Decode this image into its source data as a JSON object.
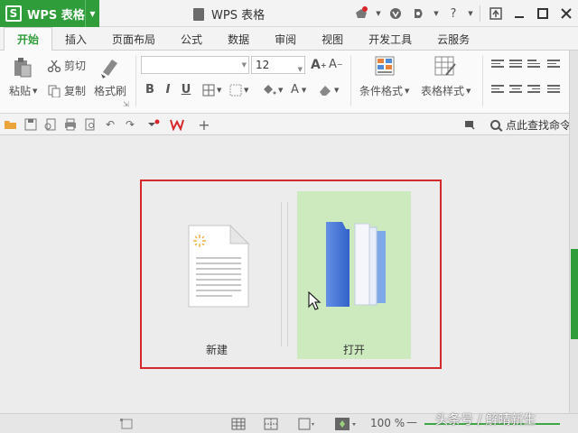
{
  "titlebar": {
    "app_name": "WPS 表格",
    "logo_letter": "S",
    "document_title": "WPS 表格"
  },
  "tabs": [
    {
      "label": "开始",
      "active": true
    },
    {
      "label": "插入"
    },
    {
      "label": "页面布局"
    },
    {
      "label": "公式"
    },
    {
      "label": "数据"
    },
    {
      "label": "审阅"
    },
    {
      "label": "视图"
    },
    {
      "label": "开发工具"
    },
    {
      "label": "云服务"
    }
  ],
  "ribbon": {
    "paste": "粘贴",
    "cut": "剪切",
    "copy": "复制",
    "format_painter": "格式刷",
    "font_name": "",
    "font_size": "12",
    "bold": "B",
    "italic": "I",
    "underline": "U",
    "conditional_format": "条件格式",
    "table_style": "表格样式"
  },
  "qat": {
    "search_commands": "点此查找命令"
  },
  "start_panel": {
    "new_label": "新建",
    "open_label": "打开"
  },
  "statusbar": {
    "zoom": "100 %",
    "minus": "—"
  },
  "watermark": "头条号 / 解晴新生",
  "colors": {
    "brand_green": "#2e9d3a",
    "highlight_red": "#d6282a",
    "open_panel_bg": "#cdeabf"
  }
}
